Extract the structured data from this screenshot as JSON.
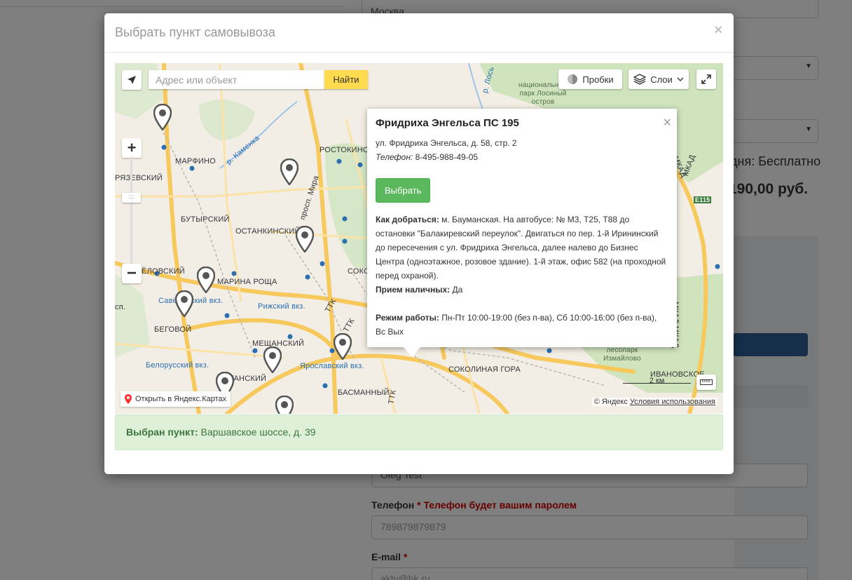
{
  "background": {
    "city_field": "Москва",
    "delivery_text": "дня: Бесплатно",
    "price_text": "190,00 руб.",
    "name_value": "Oleg Test",
    "phone_label": "Телефон",
    "phone_required": "*",
    "phone_note": "Телефон будет вашим паролем",
    "phone_value": "789879879879",
    "email_label": "E-mail",
    "email_required": "*",
    "email_value": "akty@bk.ru"
  },
  "modal": {
    "title": "Выбрать пункт самовывоза",
    "close": "×"
  },
  "map": {
    "search_placeholder": "Адрес или объект",
    "search_button": "Найти",
    "traffic_button": "Пробки",
    "layers_button": "Слои",
    "open_in_yandex": "Открыть в Яндекс.Картах",
    "copyright": "© Яндекс",
    "terms": "Условия использования",
    "scale": "2 км",
    "labels": {
      "marfino": "МАРФИНО",
      "rostokino": "РОСТОКИНО",
      "ryazevsky": "РЯЗЕВСКИЙ",
      "butyrsky": "БУТЫРСКИЙ",
      "ostankinsky": "ОСТАНКИНСКИЙ",
      "marina_roscha": "МАРИНА РОЩА",
      "zelovsky": "ЁЛОВСКИЙ",
      "begovoy": "БЕГОВОЙ",
      "meshchansky": "МЕЩАНСКИЙ",
      "tagansky": "ТАГАНСКИЙ",
      "basmanny": "БАСМАННЫЙ",
      "sokolnaya_gora": "СОКОЛИНАЯ ГОРА",
      "ivanovskoe": "ИВАНОВСКОЕ",
      "soko": "СОКО",
      "savelovsky": "Савёловский вкз.",
      "rizhsky": "Рижский вкз.",
      "belorussky": "Белорусский вкз.",
      "yaroslavsky": "Ярославский вкз.",
      "kamenka": "р. Каменка",
      "los": "р. Лось",
      "prosp_mira": "просп. Мира",
      "ttk1": "ТТК",
      "ttk2": "ТТК",
      "ttk3": "ТТК",
      "mkad1": "МКАД",
      "mkad2": "МКАД",
      "mkad3": "МКАД МКАД",
      "e115": "E115",
      "natl_park": "национальный парк Лосиный остров",
      "izmailovo": "лесопарк Измайлово",
      "sp": "сп."
    }
  },
  "balloon": {
    "title": "Фридриха Энгельса ПС 195",
    "address": "ул. Фридриха Энгельса, д. 58, стр. 2",
    "phone_label": "Телефон:",
    "phone": "8-495-988-49-05",
    "select_button": "Выбрать",
    "how_label": "Как добраться:",
    "how_text": "м. Бауманская. На автобусе: № М3, Т25, Т88 до остановки \"Балакиревский переулок\". Двигаться по пер. 1-й Ирининский до пересечения с ул. Фридриха Энгельса, далее налево до Бизнес Центра (одноэтажное, розовое здание). 1-й этаж, офис 582 (на проходной перед охраной).",
    "cash_label": "Прием наличных:",
    "cash_value": "Да",
    "hours_label": "Режим работы:",
    "hours_value": "Пн-Пт 10:00-19:00 (без п-ва), Сб 10:00-16:00 (без п-ва), Вс Вых"
  },
  "selected": {
    "label": "Выбран пункт:",
    "value": "Варшавское шоссе, д. 39"
  },
  "colors": {
    "overlay": "#000000",
    "accent_green": "#5cb85c",
    "search_yellow": "#ffdb4d",
    "selected_bg": "#dff0d8",
    "selected_text": "#3c763d",
    "required_red": "#cc0000"
  }
}
